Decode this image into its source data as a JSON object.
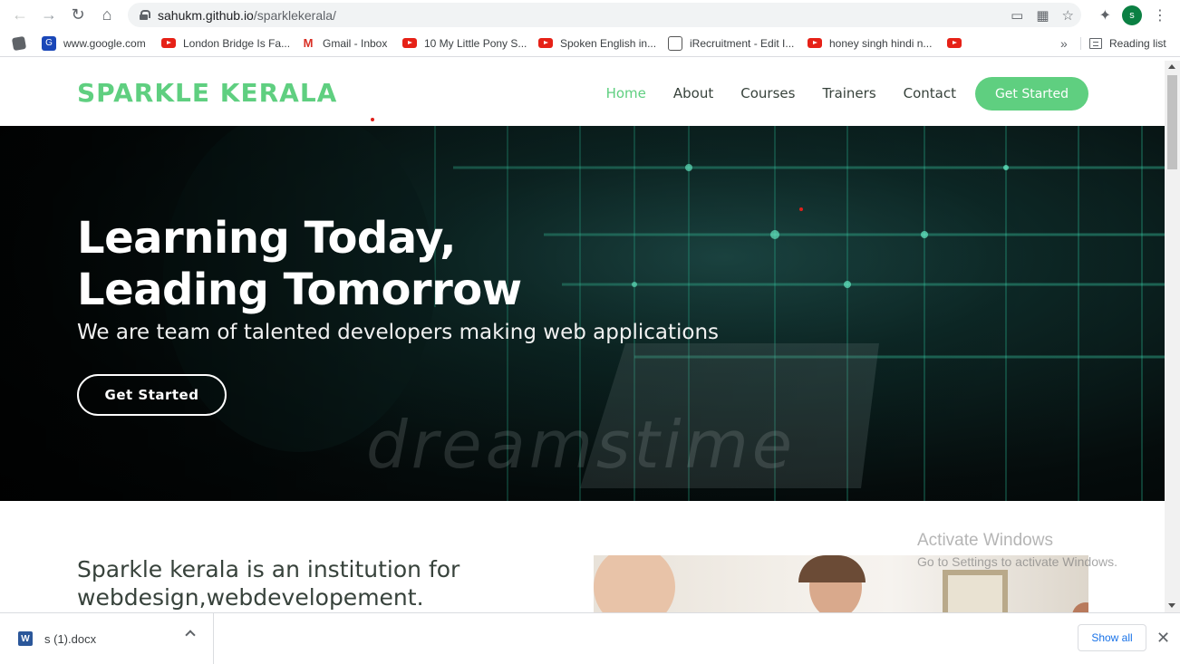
{
  "browser": {
    "url_host": "sahukm.github.io",
    "url_path": "/sparklekerala/",
    "profile_initial": "s",
    "bookmarks": [
      {
        "label": "",
        "icon": "apps-icon"
      },
      {
        "label": "www.google.com",
        "icon": "google-icon"
      },
      {
        "label": "London Bridge Is Fa...",
        "icon": "youtube-icon"
      },
      {
        "label": "Gmail - Inbox",
        "icon": "gmail-icon"
      },
      {
        "label": "10 My Little Pony S...",
        "icon": "youtube-icon"
      },
      {
        "label": "Spoken English in...",
        "icon": "youtube-icon"
      },
      {
        "label": "iRecruitment - Edit I...",
        "icon": "irecruitment-icon"
      },
      {
        "label": "honey singh hindi n...",
        "icon": "youtube-icon"
      },
      {
        "label": "",
        "icon": "youtube-icon"
      }
    ],
    "more_bookmarks": "»",
    "reading_list": "Reading list"
  },
  "site": {
    "logo": "SPARKLE KERALA",
    "nav": [
      {
        "label": "Home",
        "active": true
      },
      {
        "label": "About",
        "active": false
      },
      {
        "label": "Courses",
        "active": false
      },
      {
        "label": "Trainers",
        "active": false
      },
      {
        "label": "Contact",
        "active": false
      }
    ],
    "nav_cta": "Get Started",
    "accent_color": "#5fcf80"
  },
  "hero": {
    "title_line1": "Learning Today,",
    "title_line2": "Leading Tomorrow",
    "subtitle": "We are team of talented developers making web applications",
    "cta": "Get Started",
    "watermark": "dreamstime"
  },
  "about": {
    "text_line1": "Sparkle kerala is an institution for",
    "text_line2": "webdesign,webdevelopement."
  },
  "windows": {
    "activate_title": "Activate Windows",
    "activate_sub": "Go to Settings to activate Windows."
  },
  "downloads": {
    "file_name": "s (1).docx",
    "show_all": "Show all"
  }
}
